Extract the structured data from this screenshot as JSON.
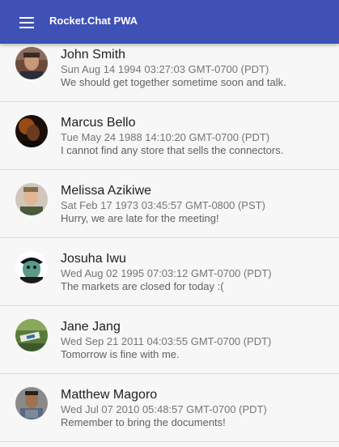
{
  "header": {
    "title": "Rocket.Chat PWA",
    "background": "#3f51b5"
  },
  "messages": [
    {
      "name": "John Smith",
      "date": "Sun Aug 14 1994 03:27:03 GMT-0700 (PDT)",
      "text": "We should get together sometime soon and talk."
    },
    {
      "name": "Marcus Bello",
      "date": "Tue May 24 1988 14:10:20 GMT-0700 (PDT)",
      "text": "I cannot find any store that sells the connectors."
    },
    {
      "name": "Melissa Azikiwe",
      "date": "Sat Feb 17 1973 03:45:57 GMT-0800 (PST)",
      "text": "Hurry, we are late for the meeting!"
    },
    {
      "name": "Josuha Iwu",
      "date": "Wed Aug 02 1995 07:03:12 GMT-0700 (PDT)",
      "text": "The markets are closed for today :("
    },
    {
      "name": "Jane Jang",
      "date": "Wed Sep 21 2011 04:03:55 GMT-0700 (PDT)",
      "text": "Tomorrow is fine with me."
    },
    {
      "name": "Matthew Magoro",
      "date": "Wed Jul 07 2010 05:48:57 GMT-0700 (PDT)",
      "text": "Remember to bring the documents!"
    }
  ]
}
